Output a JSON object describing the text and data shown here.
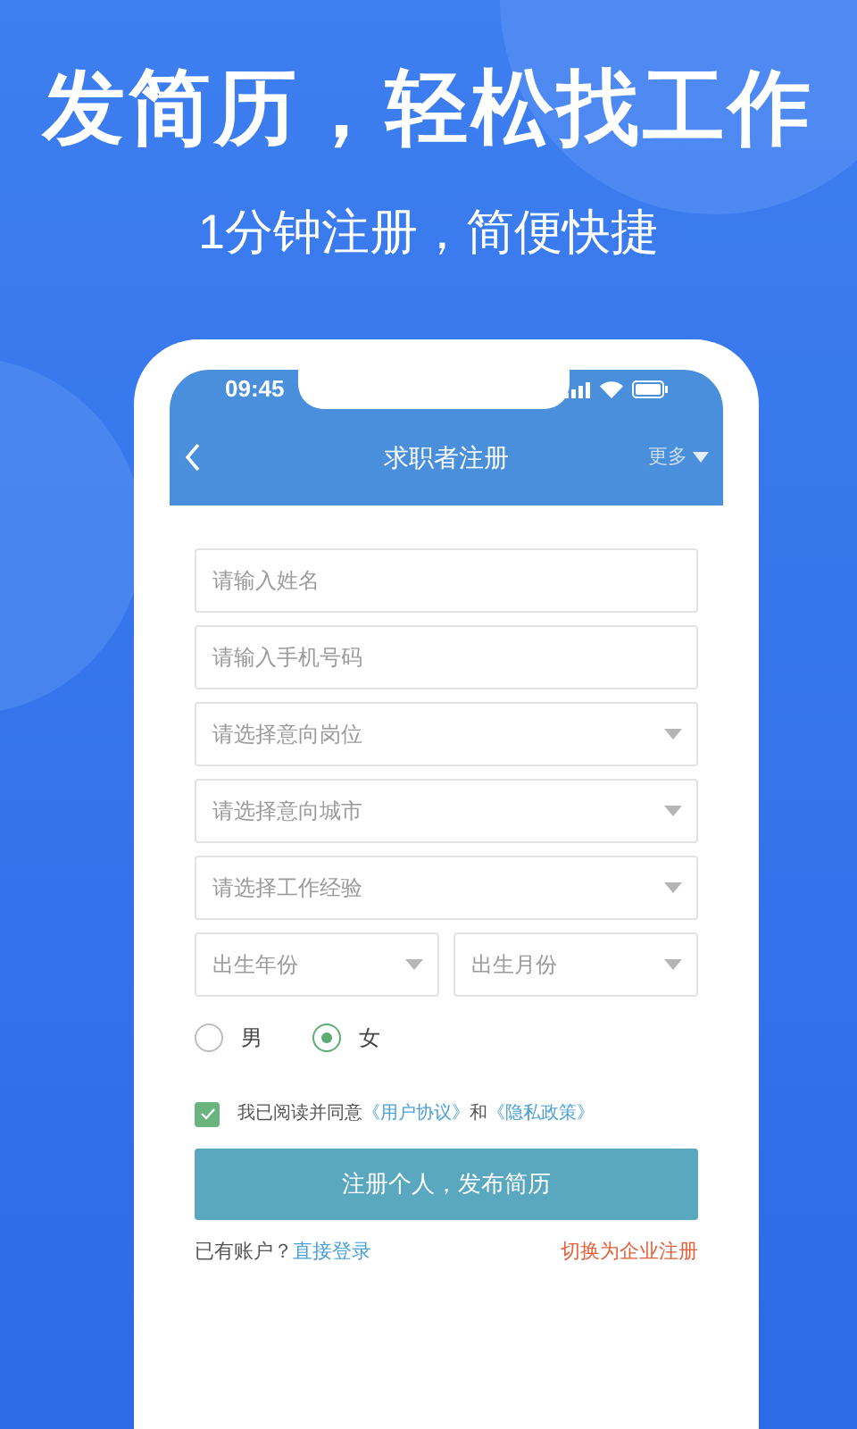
{
  "headline": "发简历，轻松找工作",
  "subtitle": "1分钟注册，简便快捷",
  "status_bar": {
    "time": "09:45"
  },
  "nav": {
    "title": "求职者注册",
    "more": "更多"
  },
  "fields": [
    {
      "kind": "text",
      "placeholder": "请输入姓名"
    },
    {
      "kind": "text",
      "placeholder": "请输入手机号码"
    },
    {
      "kind": "select",
      "placeholder": "请选择意向岗位"
    },
    {
      "kind": "select",
      "placeholder": "请选择意向城市"
    },
    {
      "kind": "select",
      "placeholder": "请选择工作经验"
    }
  ],
  "birth_fields": [
    {
      "kind": "select",
      "placeholder": "出生年份"
    },
    {
      "kind": "select",
      "placeholder": "出生月份"
    }
  ],
  "gender": [
    {
      "label": "男",
      "selected": false
    },
    {
      "label": "女",
      "selected": true
    }
  ],
  "agreement": {
    "checked": true,
    "text": "我已阅读并同意",
    "link1": "《用户协议》",
    "and": "和",
    "link2": "《隐私政策》"
  },
  "submit": "注册个人，发布简历",
  "footer": {
    "prompt": "已有账户？",
    "login": "直接登录",
    "switch": "切换为企业注册"
  }
}
